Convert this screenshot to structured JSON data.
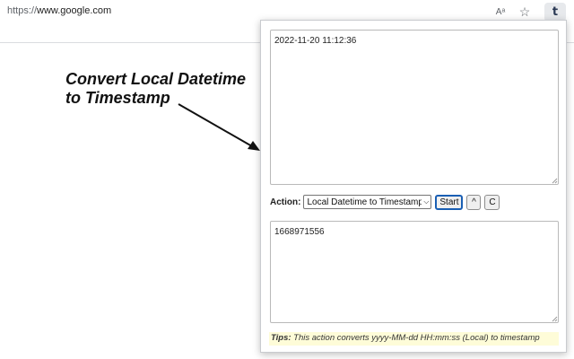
{
  "browser": {
    "url_scheme": "https://",
    "url_host": "www.google.com",
    "read_aloud_icon": "Aᵃ",
    "favorite_icon": "☆",
    "extension_icon": "t"
  },
  "annotation": {
    "line1": "Convert Local Datetime",
    "line2": "to Timestamp"
  },
  "popup": {
    "input_value": "2022-11-20 11:12:36",
    "action_label": "Action:",
    "action_selected": "Local Datetime to Timestamp",
    "start_label": "Start",
    "up_label": "^",
    "clear_label": "C",
    "output_value": "1668971556",
    "tips_label": "Tips:",
    "tips_text": " This action converts yyyy-MM-dd HH:mm:ss (Local) to timestamp"
  }
}
